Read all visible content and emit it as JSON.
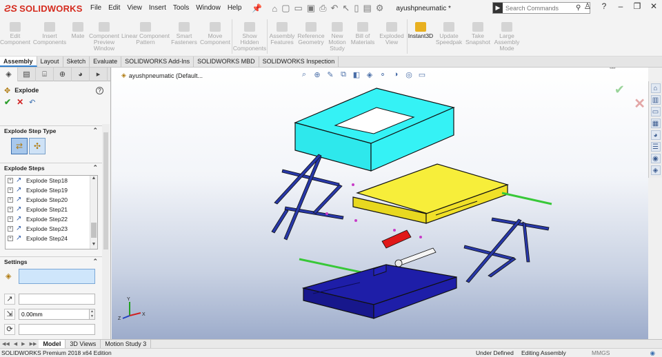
{
  "app": {
    "logo": "SOLIDWORKS",
    "menu": [
      "File",
      "Edit",
      "View",
      "Insert",
      "Tools",
      "Window",
      "Help"
    ],
    "doc_title": "ayushpneumatic *",
    "search_placeholder": "Search Commands"
  },
  "commands": [
    {
      "label": "Edit\nComponent",
      "active": false
    },
    {
      "label": "Insert\nComponents",
      "active": false
    },
    {
      "label": "Mate",
      "active": false
    },
    {
      "label": "Component\nPreview\nWindow",
      "active": false
    },
    {
      "label": "Linear Component\nPattern",
      "active": false
    },
    {
      "label": "Smart\nFasteners",
      "active": false
    },
    {
      "label": "Move\nComponent",
      "active": false
    },
    {
      "label": "Show\nHidden\nComponents",
      "active": false
    },
    {
      "label": "Assembly\nFeatures",
      "active": false
    },
    {
      "label": "Reference\nGeometry",
      "active": false
    },
    {
      "label": "New\nMotion\nStudy",
      "active": false
    },
    {
      "label": "Bill of\nMaterials",
      "active": false
    },
    {
      "label": "Exploded\nView",
      "active": false
    },
    {
      "label": "Instant3D",
      "active": true
    },
    {
      "label": "Update\nSpeedpak",
      "active": false
    },
    {
      "label": "Take\nSnapshot",
      "active": false
    },
    {
      "label": "Large\nAssembly\nMode",
      "active": false
    }
  ],
  "tabs": [
    "Assembly",
    "Layout",
    "Sketch",
    "Evaluate",
    "SOLIDWORKS Add-Ins",
    "SOLIDWORKS MBD",
    "SOLIDWORKS Inspection"
  ],
  "panel": {
    "title": "Explode",
    "explode_step_type_label": "Explode Step Type",
    "explode_steps_label": "Explode Steps",
    "steps": [
      "Explode Step18",
      "Explode Step19",
      "Explode Step20",
      "Explode Step21",
      "Explode Step22",
      "Explode Step23",
      "Explode Step24"
    ],
    "settings_label": "Settings",
    "distance_value": "0.00mm"
  },
  "viewport": {
    "tree_label": "ayushpneumatic  (Default..."
  },
  "bottom_tabs": [
    "Model",
    "3D Views",
    "Motion Study 3"
  ],
  "status": {
    "edition": "SOLIDWORKS Premium 2018 x64 Edition",
    "definition": "Under Defined",
    "mode": "Editing Assembly",
    "units": "MMGS"
  },
  "colors": {
    "accent": "#2f7fd0",
    "cyan_part": "#35f2f5",
    "yellow_part": "#f7ee3a",
    "blue_part": "#1e1ea8",
    "rod_blue": "#2838a8",
    "rod_green": "#38c838",
    "piston_red": "#e01818"
  }
}
